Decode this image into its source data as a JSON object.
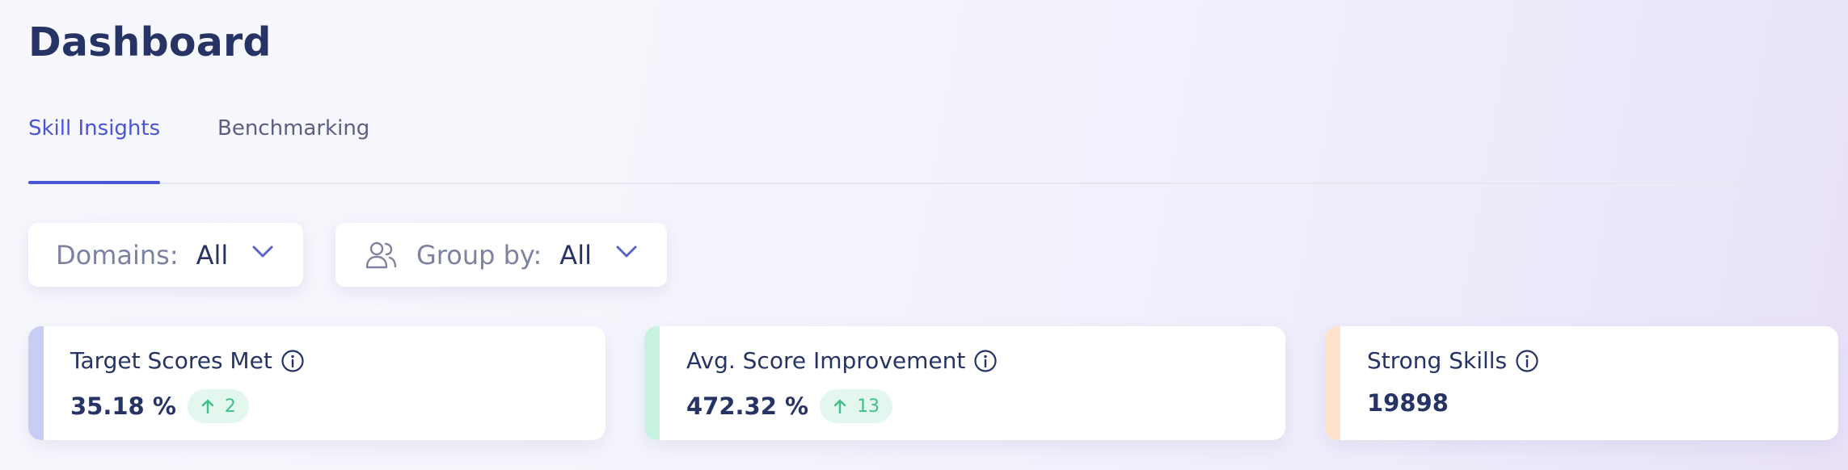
{
  "page": {
    "title": "Dashboard"
  },
  "tabs": [
    {
      "label": "Skill Insights",
      "active": true
    },
    {
      "label": "Benchmarking",
      "active": false
    }
  ],
  "filters": {
    "domains": {
      "label": "Domains:",
      "value": "All",
      "icon": "chevron-down-icon"
    },
    "group_by": {
      "label": "Group by:",
      "value": "All",
      "icon": "people-icon"
    }
  },
  "cards": [
    {
      "title": "Target Scores Met",
      "value": "35.18 %",
      "badge": "2",
      "accent": "#c9ccf4"
    },
    {
      "title": "Avg. Score Improvement",
      "value": "472.32 %",
      "badge": "13",
      "accent": "#c7f2df"
    },
    {
      "title": "Strong Skills",
      "value": "19898",
      "accent": "#fde3cb"
    }
  ],
  "colors": {
    "accent_blue": "#4a55d6",
    "title_navy": "#253365",
    "positive_green": "#3ec089"
  }
}
